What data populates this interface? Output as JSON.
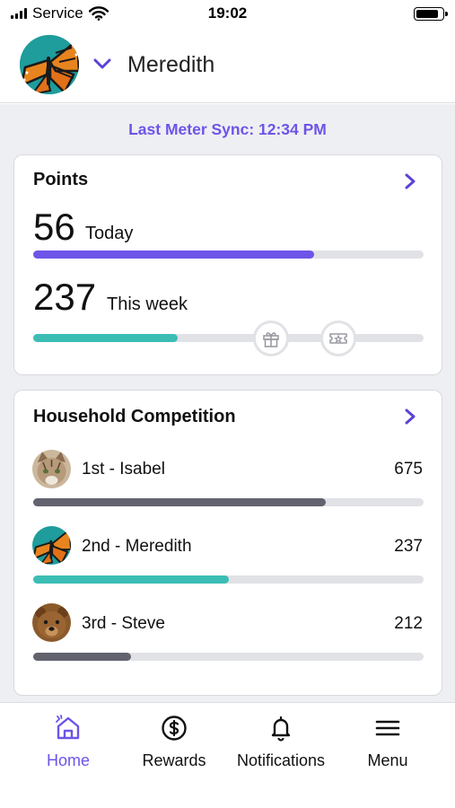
{
  "status_bar": {
    "carrier": "Service",
    "time": "19:02"
  },
  "header": {
    "user_name": "Meredith"
  },
  "sync": {
    "text": "Last Meter Sync: 12:34 PM"
  },
  "points": {
    "title": "Points",
    "today_value": "56",
    "today_label": "Today",
    "today_progress": 0.72,
    "week_value": "237",
    "week_label": "This week",
    "week_progress": 0.37,
    "milestones": [
      "gift-icon",
      "ticket-icon"
    ]
  },
  "competition": {
    "title": "Household Competition",
    "entries": [
      {
        "label": "1st - Isabel",
        "value": "675",
        "progress": 0.75,
        "color": "#62636f"
      },
      {
        "label": "2nd - Meredith",
        "value": "237",
        "progress": 0.5,
        "color": "#3bbdb4"
      },
      {
        "label": "3rd - Steve",
        "value": "212",
        "progress": 0.25,
        "color": "#62636f"
      }
    ]
  },
  "nav": {
    "items": [
      {
        "label": "Home",
        "icon": "home-icon",
        "active": true
      },
      {
        "label": "Rewards",
        "icon": "dollar-icon",
        "active": false
      },
      {
        "label": "Notifications",
        "icon": "bell-icon",
        "active": false
      },
      {
        "label": "Menu",
        "icon": "menu-icon",
        "active": false
      }
    ]
  },
  "colors": {
    "accent": "#6e54e8",
    "teal": "#3bbdb4",
    "track": "#e1e2e6",
    "neutral_bar": "#62636f"
  }
}
